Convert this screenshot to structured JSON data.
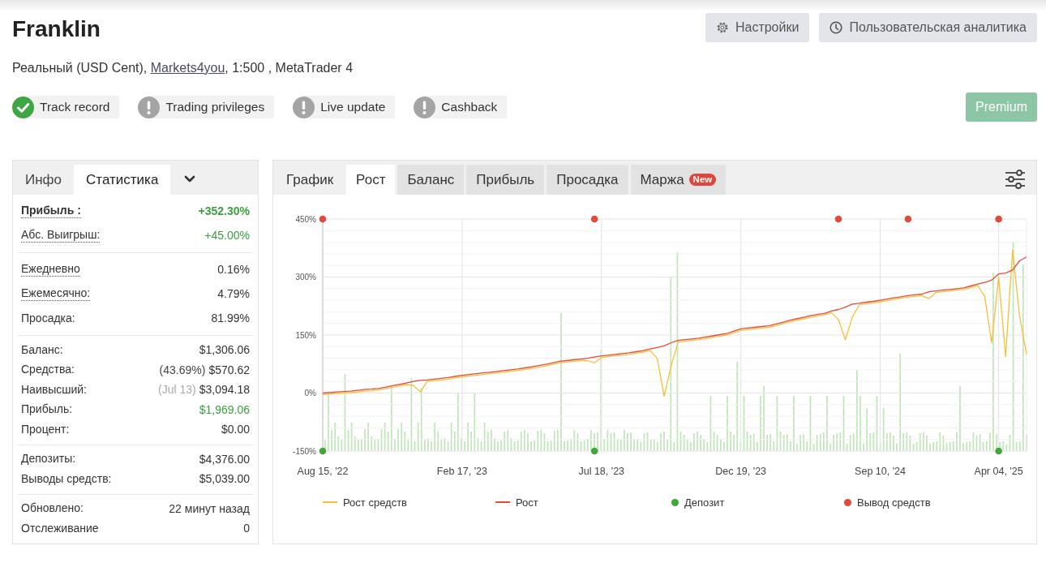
{
  "header": {
    "title": "Franklin",
    "account": {
      "text_before": "Реальный (USD Cent),",
      "broker": "Markets4you",
      "text_after": ", 1:500 , MetaTrader 4"
    }
  },
  "actions": [
    {
      "kind": "settings",
      "label": "Настройки"
    },
    {
      "kind": "analytics",
      "label": "Пользовательская аналитика"
    }
  ],
  "badges": [
    {
      "label": "Track record",
      "verified": true
    },
    {
      "label": "Trading privileges",
      "verified": false
    },
    {
      "label": "Live update",
      "verified": false
    },
    {
      "label": "Cashback",
      "verified": false
    }
  ],
  "premium_button": {
    "label": "Premium"
  },
  "stats_panel": {
    "tabs": [
      {
        "label": "Инфо",
        "selected": false
      },
      {
        "label": "Статистика",
        "selected": true
      }
    ],
    "sections": [
      {
        "rows": [
          {
            "label": "Прибыль :",
            "value": "+352.30%",
            "hint": true,
            "emphasized": true,
            "positive": true
          },
          {
            "label": "Абс. Выигрыш:",
            "value": "+45.00%",
            "hint": true,
            "emphasized": false,
            "positive": true
          }
        ]
      },
      {
        "rows": [
          {
            "label": "Ежедневно",
            "value": "0.16%",
            "hint": true,
            "emphasized": false,
            "positive": false
          },
          {
            "label": "Ежемесячно:",
            "value": "4.79%",
            "hint": true,
            "emphasized": false,
            "positive": false
          },
          {
            "label": "Просадка:",
            "value": "81.99%",
            "hint": false,
            "emphasized": false,
            "positive": false
          }
        ]
      },
      {
        "rows": [
          {
            "label": "Баланс:",
            "value": "$1,306.06",
            "hint": false,
            "emphasized": false,
            "positive": false
          },
          {
            "label": "Средства:",
            "note": {
              "text": "(43.69%)",
              "muted": false
            },
            "value": "$570.62",
            "hint": false,
            "emphasized": false,
            "positive": false
          },
          {
            "label": "Наивысший:",
            "note": {
              "text": "(Jul 13)",
              "muted": true
            },
            "value": "$3,094.18",
            "hint": false,
            "emphasized": false,
            "positive": false
          },
          {
            "label": "Прибыль:",
            "value": "$1,969.06",
            "hint": false,
            "emphasized": false,
            "positive": true
          },
          {
            "label": "Процент:",
            "value": "$0.00",
            "hint": false,
            "emphasized": false,
            "positive": false
          }
        ]
      },
      {
        "rows": [
          {
            "label": "Депозиты:",
            "value": "$4,376.00",
            "hint": false,
            "emphasized": false,
            "positive": false
          },
          {
            "label": "Выводы средств:",
            "value": "$5,039.00",
            "hint": false,
            "emphasized": false,
            "positive": false
          }
        ]
      },
      {
        "rows": [
          {
            "label": "Обновлено:",
            "value": "22 минут назад",
            "hint": false,
            "emphasized": false,
            "positive": false
          },
          {
            "label": "Отслеживание",
            "value": "0",
            "hint": false,
            "emphasized": false,
            "positive": false
          }
        ]
      }
    ]
  },
  "chart_panel": {
    "heading": "График",
    "tabs": [
      {
        "label": "Рост",
        "selected": true
      },
      {
        "label": "Баланс",
        "selected": false
      },
      {
        "label": "Прибыль",
        "selected": false
      },
      {
        "label": "Просадка",
        "selected": false
      },
      {
        "label": "Маржа",
        "selected": false,
        "badge": "New"
      }
    ],
    "chart_data": {
      "type": "line",
      "grid": true,
      "legend": "bottom",
      "categories": [
        "Aug 15, '22",
        null,
        null,
        null,
        null,
        null,
        null,
        null,
        null,
        null,
        null,
        null,
        null,
        null,
        null,
        null,
        null,
        null,
        null,
        null,
        "Feb 17, '23",
        null,
        null,
        null,
        null,
        null,
        null,
        null,
        null,
        null,
        null,
        null,
        null,
        null,
        null,
        null,
        null,
        null,
        null,
        null,
        "Jul 18, '23",
        null,
        null,
        null,
        null,
        null,
        null,
        null,
        null,
        null,
        null,
        null,
        null,
        null,
        null,
        null,
        null,
        null,
        null,
        null,
        "Dec 19, '23",
        null,
        null,
        null,
        null,
        null,
        null,
        null,
        null,
        null,
        null,
        null,
        null,
        null,
        null,
        null,
        null,
        null,
        null,
        null,
        "Sep 10, '24",
        null,
        null,
        null,
        null,
        null,
        null,
        null,
        null,
        null,
        null,
        null,
        null,
        null,
        null,
        null,
        null,
        "Apr 04, '25",
        null,
        null,
        null,
        null
      ],
      "ylim": [
        -150,
        450
      ],
      "yticks": [
        {
          "value": 450,
          "label": "450%"
        },
        {
          "value": 300,
          "label": "300%"
        },
        {
          "value": 150,
          "label": "150%"
        },
        {
          "value": 0,
          "label": "0%"
        },
        {
          "value": -150,
          "label": "-150%"
        }
      ],
      "series": [
        {
          "name": "Рост средств",
          "color": "#f5bf3a",
          "type": "line",
          "values": [
            -4,
            -3,
            -1,
            0,
            1,
            3,
            5,
            6,
            8,
            11,
            15,
            18,
            22,
            20,
            3,
            30,
            32,
            34,
            36,
            39,
            42,
            44,
            46,
            48,
            50,
            52,
            54,
            56,
            58,
            61,
            64,
            67,
            70,
            74,
            78,
            80,
            82,
            84,
            84,
            78,
            92,
            94,
            96,
            98,
            100,
            103,
            106,
            110,
            90,
            -8,
            70,
            132,
            134,
            136,
            138,
            141,
            144,
            147,
            150,
            156,
            162,
            164,
            166,
            168,
            170,
            174,
            179,
            184,
            188,
            192,
            196,
            199,
            202,
            208,
            190,
            138,
            196,
            228,
            231,
            233,
            236,
            239,
            242,
            245,
            248,
            250,
            252,
            244,
            260,
            262,
            264,
            266,
            268,
            273,
            278,
            250,
            130,
            300,
            94,
            370,
            200,
            100
          ]
        },
        {
          "name": "Рост",
          "color": "#e5493a",
          "type": "line",
          "values": [
            0,
            1,
            3,
            4,
            5,
            7,
            9,
            10,
            12,
            15,
            19,
            22,
            26,
            30,
            33,
            34,
            36,
            38,
            40,
            43,
            46,
            48,
            50,
            52,
            54,
            56,
            58,
            60,
            62,
            65,
            68,
            71,
            74,
            78,
            82,
            84,
            86,
            88,
            90,
            93,
            96,
            98,
            100,
            102,
            104,
            107,
            110,
            114,
            118,
            122,
            130,
            136,
            138,
            140,
            142,
            145,
            148,
            151,
            154,
            160,
            166,
            168,
            170,
            172,
            174,
            178,
            183,
            188,
            192,
            196,
            200,
            203,
            206,
            212,
            216,
            222,
            230,
            232,
            235,
            237,
            240,
            243,
            246,
            249,
            252,
            254,
            256,
            262,
            264,
            266,
            268,
            270,
            272,
            277,
            282,
            286,
            292,
            308,
            310,
            318,
            342,
            352
          ]
        },
        {
          "name": "Депозит",
          "color": "#41a63c",
          "type": "scatter",
          "values": [
            -150,
            null,
            null,
            null,
            null,
            null,
            null,
            null,
            null,
            null,
            null,
            null,
            null,
            null,
            null,
            null,
            null,
            null,
            null,
            null,
            null,
            null,
            null,
            null,
            null,
            null,
            null,
            null,
            null,
            null,
            null,
            null,
            null,
            null,
            null,
            null,
            null,
            null,
            null,
            -150,
            null,
            null,
            null,
            null,
            null,
            null,
            null,
            null,
            null,
            null,
            null,
            null,
            null,
            null,
            null,
            null,
            null,
            null,
            null,
            null,
            null,
            null,
            null,
            null,
            null,
            null,
            null,
            null,
            null,
            null,
            null,
            null,
            null,
            null,
            null,
            null,
            null,
            null,
            null,
            null,
            null,
            null,
            null,
            null,
            null,
            null,
            null,
            null,
            null,
            null,
            null,
            null,
            null,
            null,
            null,
            null,
            null,
            -150,
            null,
            null,
            null,
            null
          ]
        },
        {
          "name": "Вывод средств",
          "color": "#e5493a",
          "type": "scatter",
          "values": [
            450,
            null,
            null,
            null,
            null,
            null,
            null,
            null,
            null,
            null,
            null,
            null,
            null,
            null,
            null,
            null,
            null,
            null,
            null,
            null,
            null,
            null,
            null,
            null,
            null,
            null,
            null,
            null,
            null,
            null,
            null,
            null,
            null,
            null,
            null,
            null,
            null,
            null,
            null,
            450,
            null,
            null,
            null,
            null,
            null,
            null,
            null,
            null,
            null,
            null,
            null,
            null,
            null,
            null,
            null,
            null,
            null,
            null,
            null,
            null,
            null,
            null,
            null,
            null,
            null,
            null,
            null,
            null,
            null,
            null,
            null,
            null,
            null,
            null,
            450,
            null,
            null,
            null,
            null,
            null,
            null,
            null,
            null,
            null,
            450,
            null,
            null,
            null,
            null,
            null,
            null,
            null,
            null,
            null,
            null,
            null,
            null,
            450,
            null,
            null,
            null,
            null
          ]
        }
      ]
    }
  }
}
